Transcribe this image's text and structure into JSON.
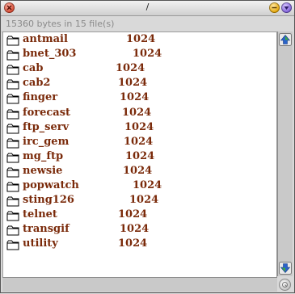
{
  "window": {
    "title": "/"
  },
  "status": {
    "text": "15360 bytes in 15 file(s)"
  },
  "files": [
    {
      "name": "antmail",
      "size": "1024"
    },
    {
      "name": "bnet_303",
      "size": "1024"
    },
    {
      "name": "cab",
      "size": "1024"
    },
    {
      "name": "cab2",
      "size": "1024"
    },
    {
      "name": "finger",
      "size": "1024"
    },
    {
      "name": "forecast",
      "size": "1024"
    },
    {
      "name": "ftp_serv",
      "size": "1024"
    },
    {
      "name": "irc_gem",
      "size": "1024"
    },
    {
      "name": "mg_ftp",
      "size": "1024"
    },
    {
      "name": "newsie",
      "size": "1024"
    },
    {
      "name": "popwatch",
      "size": "1024"
    },
    {
      "name": "sting126",
      "size": "1024"
    },
    {
      "name": "telnet",
      "size": "1024"
    },
    {
      "name": "transgif",
      "size": "1024"
    },
    {
      "name": "utility",
      "size": "1024"
    }
  ],
  "icons": {
    "close": "close-icon",
    "minimize": "minimize-icon",
    "zoom": "zoom-icon",
    "folder": "folder-icon",
    "scroll_up": "arrow-up-icon",
    "scroll_down": "arrow-down-icon",
    "resize": "resize-grip-icon"
  },
  "colors": {
    "filename": "#7a2a0a",
    "status": "#8a8a8a"
  }
}
